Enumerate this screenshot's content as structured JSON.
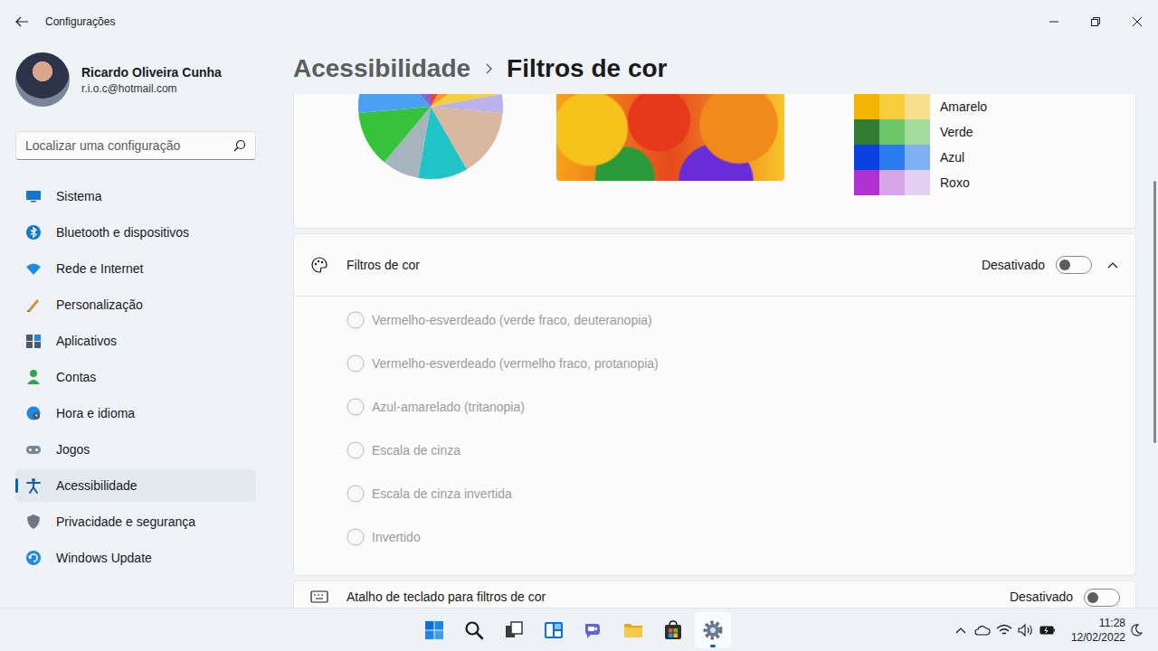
{
  "window": {
    "title": "Configurações"
  },
  "profile": {
    "name": "Ricardo Oliveira Cunha",
    "email": "r.i.o.c@hotmail.com"
  },
  "search": {
    "placeholder": "Localizar uma configuração"
  },
  "sidebar": {
    "items": [
      {
        "label": "Sistema",
        "kind": "system",
        "selected": false
      },
      {
        "label": "Bluetooth e dispositivos",
        "kind": "bluetooth",
        "selected": false
      },
      {
        "label": "Rede e Internet",
        "kind": "network",
        "selected": false
      },
      {
        "label": "Personalização",
        "kind": "personalization",
        "selected": false
      },
      {
        "label": "Aplicativos",
        "kind": "apps",
        "selected": false
      },
      {
        "label": "Contas",
        "kind": "accounts",
        "selected": false
      },
      {
        "label": "Hora e idioma",
        "kind": "time",
        "selected": false
      },
      {
        "label": "Jogos",
        "kind": "games",
        "selected": false
      },
      {
        "label": "Acessibilidade",
        "kind": "accessibility",
        "selected": true
      },
      {
        "label": "Privacidade e segurança",
        "kind": "privacy",
        "selected": false
      },
      {
        "label": "Windows Update",
        "kind": "update",
        "selected": false
      }
    ]
  },
  "breadcrumb": [
    {
      "label": "Acessibilidade",
      "current": false
    },
    {
      "label": "Filtros de cor",
      "current": true
    }
  ],
  "preview": {
    "pie": [
      {
        "value": 30,
        "color": "#e8453c"
      },
      {
        "value": 25,
        "color": "#f39a2b"
      },
      {
        "value": 25,
        "color": "#f5d23a"
      },
      {
        "value": 15,
        "color": "#b9b2ec"
      },
      {
        "value": 55,
        "color": "#d9b8a0"
      },
      {
        "value": 40,
        "color": "#1ec4c8"
      },
      {
        "value": 30,
        "color": "#a7b4bd"
      },
      {
        "value": 45,
        "color": "#36c23a"
      },
      {
        "value": 55,
        "color": "#4aa0f2"
      },
      {
        "value": 40,
        "color": "#8a63d2"
      }
    ],
    "swatches": [
      {
        "label": "Amarelo",
        "colors": [
          "#f2b500",
          "#f7cd3c",
          "#f6e08e"
        ]
      },
      {
        "label": "Verde",
        "colors": [
          "#2e7d32",
          "#6cc66a",
          "#a4dca0"
        ]
      },
      {
        "label": "Azul",
        "colors": [
          "#0a3fe0",
          "#2a7bf0",
          "#7fb0f5"
        ]
      },
      {
        "label": "Roxo",
        "colors": [
          "#b030d0",
          "#d6a6e8",
          "#e4d0f0"
        ]
      }
    ]
  },
  "color_filters": {
    "label": "Filtros de cor",
    "status": "Desativado",
    "on": false,
    "expanded": true,
    "options": [
      {
        "label": "Vermelho-esverdeado (verde fraco, deuteranopia)",
        "selected": false,
        "disabled": true
      },
      {
        "label": "Vermelho-esverdeado (vermelho fraco, protanopia)",
        "selected": false,
        "disabled": true
      },
      {
        "label": "Azul-amarelado (tritanopia)",
        "selected": false,
        "disabled": true
      },
      {
        "label": "Escala de cinza",
        "selected": false,
        "disabled": true
      },
      {
        "label": "Escala de cinza invertida",
        "selected": false,
        "disabled": true
      },
      {
        "label": "Invertido",
        "selected": false,
        "disabled": true
      }
    ]
  },
  "shortcut": {
    "label": "Atalho de teclado para filtros de cor",
    "status": "Desativado",
    "on": false
  },
  "taskbar": {
    "apps": [
      {
        "kind": "start",
        "active": false
      },
      {
        "kind": "search",
        "active": false
      },
      {
        "kind": "taskview",
        "active": false
      },
      {
        "kind": "widgets",
        "active": false
      },
      {
        "kind": "chat",
        "active": false
      },
      {
        "kind": "explorer",
        "active": false
      },
      {
        "kind": "store",
        "active": false
      },
      {
        "kind": "settings",
        "active": true
      }
    ],
    "clock": {
      "time": "11:28",
      "date": "12/02/2022"
    }
  }
}
